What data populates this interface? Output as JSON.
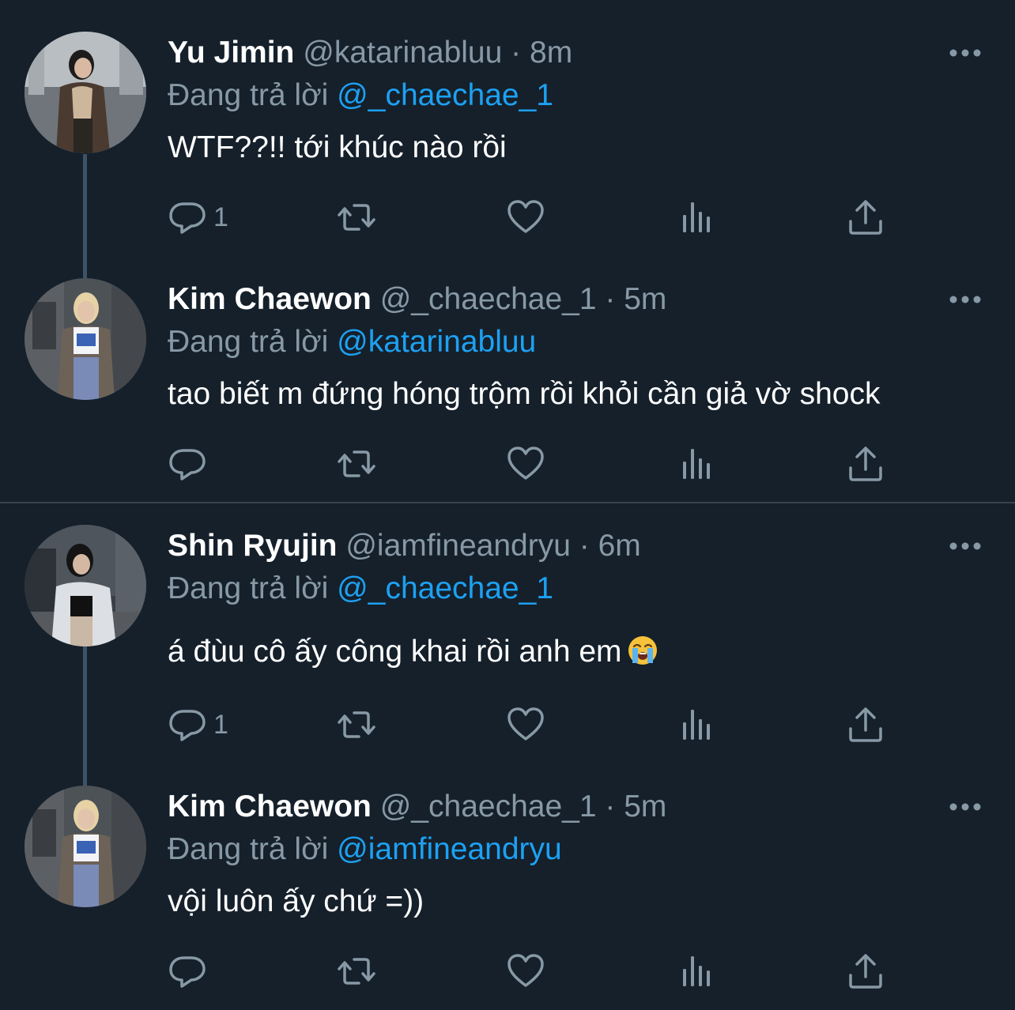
{
  "tweets": [
    {
      "name": "Yu Jimin",
      "handle": "@katarinabluu",
      "dot": "·",
      "time": "8m",
      "reply_prefix": "Đang trả lời",
      "reply_to": "@_chaechae_1",
      "text": "WTF??!! tới khúc nào rồi",
      "reply_count": "1"
    },
    {
      "name": "Kim Chaewon",
      "handle": "@_chaechae_1",
      "dot": "·",
      "time": "5m",
      "reply_prefix": "Đang trả lời",
      "reply_to": "@katarinabluu",
      "text": "tao biết m đứng hóng trộm rồi khỏi cần giả vờ shock",
      "reply_count": ""
    },
    {
      "name": "Shin Ryujin",
      "handle": "@iamfineandryu",
      "dot": "·",
      "time": "6m",
      "reply_prefix": "Đang trả lời",
      "reply_to": "@_chaechae_1",
      "text": "á đùu cô ấy công khai rồi anh em",
      "reply_count": "1"
    },
    {
      "name": "Kim Chaewon",
      "handle": "@_chaechae_1",
      "dot": "·",
      "time": "5m",
      "reply_prefix": "Đang trả lời",
      "reply_to": "@iamfineandryu",
      "text": "vội luôn ấy chứ =))",
      "reply_count": ""
    }
  ],
  "icons": {
    "reply": "reply-icon",
    "retweet": "retweet-icon",
    "like": "heart-icon",
    "views": "analytics-icon",
    "share": "share-icon",
    "more": "more-icon",
    "emoji": "loudly-crying-face-emoji"
  },
  "colors": {
    "background": "#15202b",
    "primary_text": "#ffffff",
    "secondary_text": "#8899a6",
    "link": "#1da1f2",
    "divider": "#38444d",
    "thread_line": "#3d5466"
  }
}
